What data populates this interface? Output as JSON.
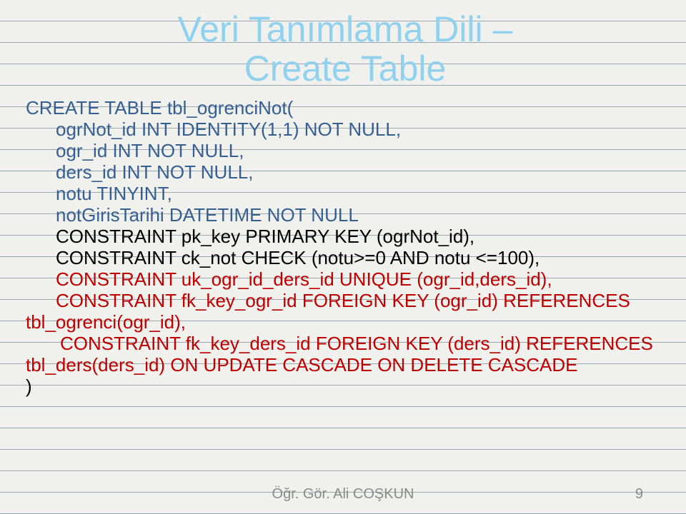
{
  "title_line1": "Veri Tanımlama Dili –",
  "title_line2": "Create Table",
  "code": {
    "l0": "CREATE TABLE tbl_ogrenciNot(",
    "l1": "ogrNot_id INT IDENTITY(1,1) NOT NULL,",
    "l2": "ogr_id INT NOT NULL,",
    "l3": "ders_id INT NOT NULL,",
    "l4": "notu TINYINT,",
    "l5": "notGirisTarihi DATETIME  NOT NULL",
    "l6": "CONSTRAINT pk_key PRIMARY KEY (ogrNot_id),",
    "l7": "CONSTRAINT ck_not CHECK (notu>=0 AND notu <=100),",
    "l8": "CONSTRAINT uk_ogr_id_ders_id UNIQUE (ogr_id,ders_id),",
    "l9a": "CONSTRAINT fk_key_ogr_id FOREIGN KEY (ogr_id) REFERENCES",
    "l9b": "tbl_ogrenci(ogr_id),",
    "l10a": "CONSTRAINT fk_key_ders_id FOREIGN KEY (ders_id) REFERENCES",
    "l10b": "tbl_ders(ders_id) ON UPDATE CASCADE ON DELETE CASCADE",
    "close": ")"
  },
  "footer": "Öğr. Gör. Ali COŞKUN",
  "page": "9"
}
